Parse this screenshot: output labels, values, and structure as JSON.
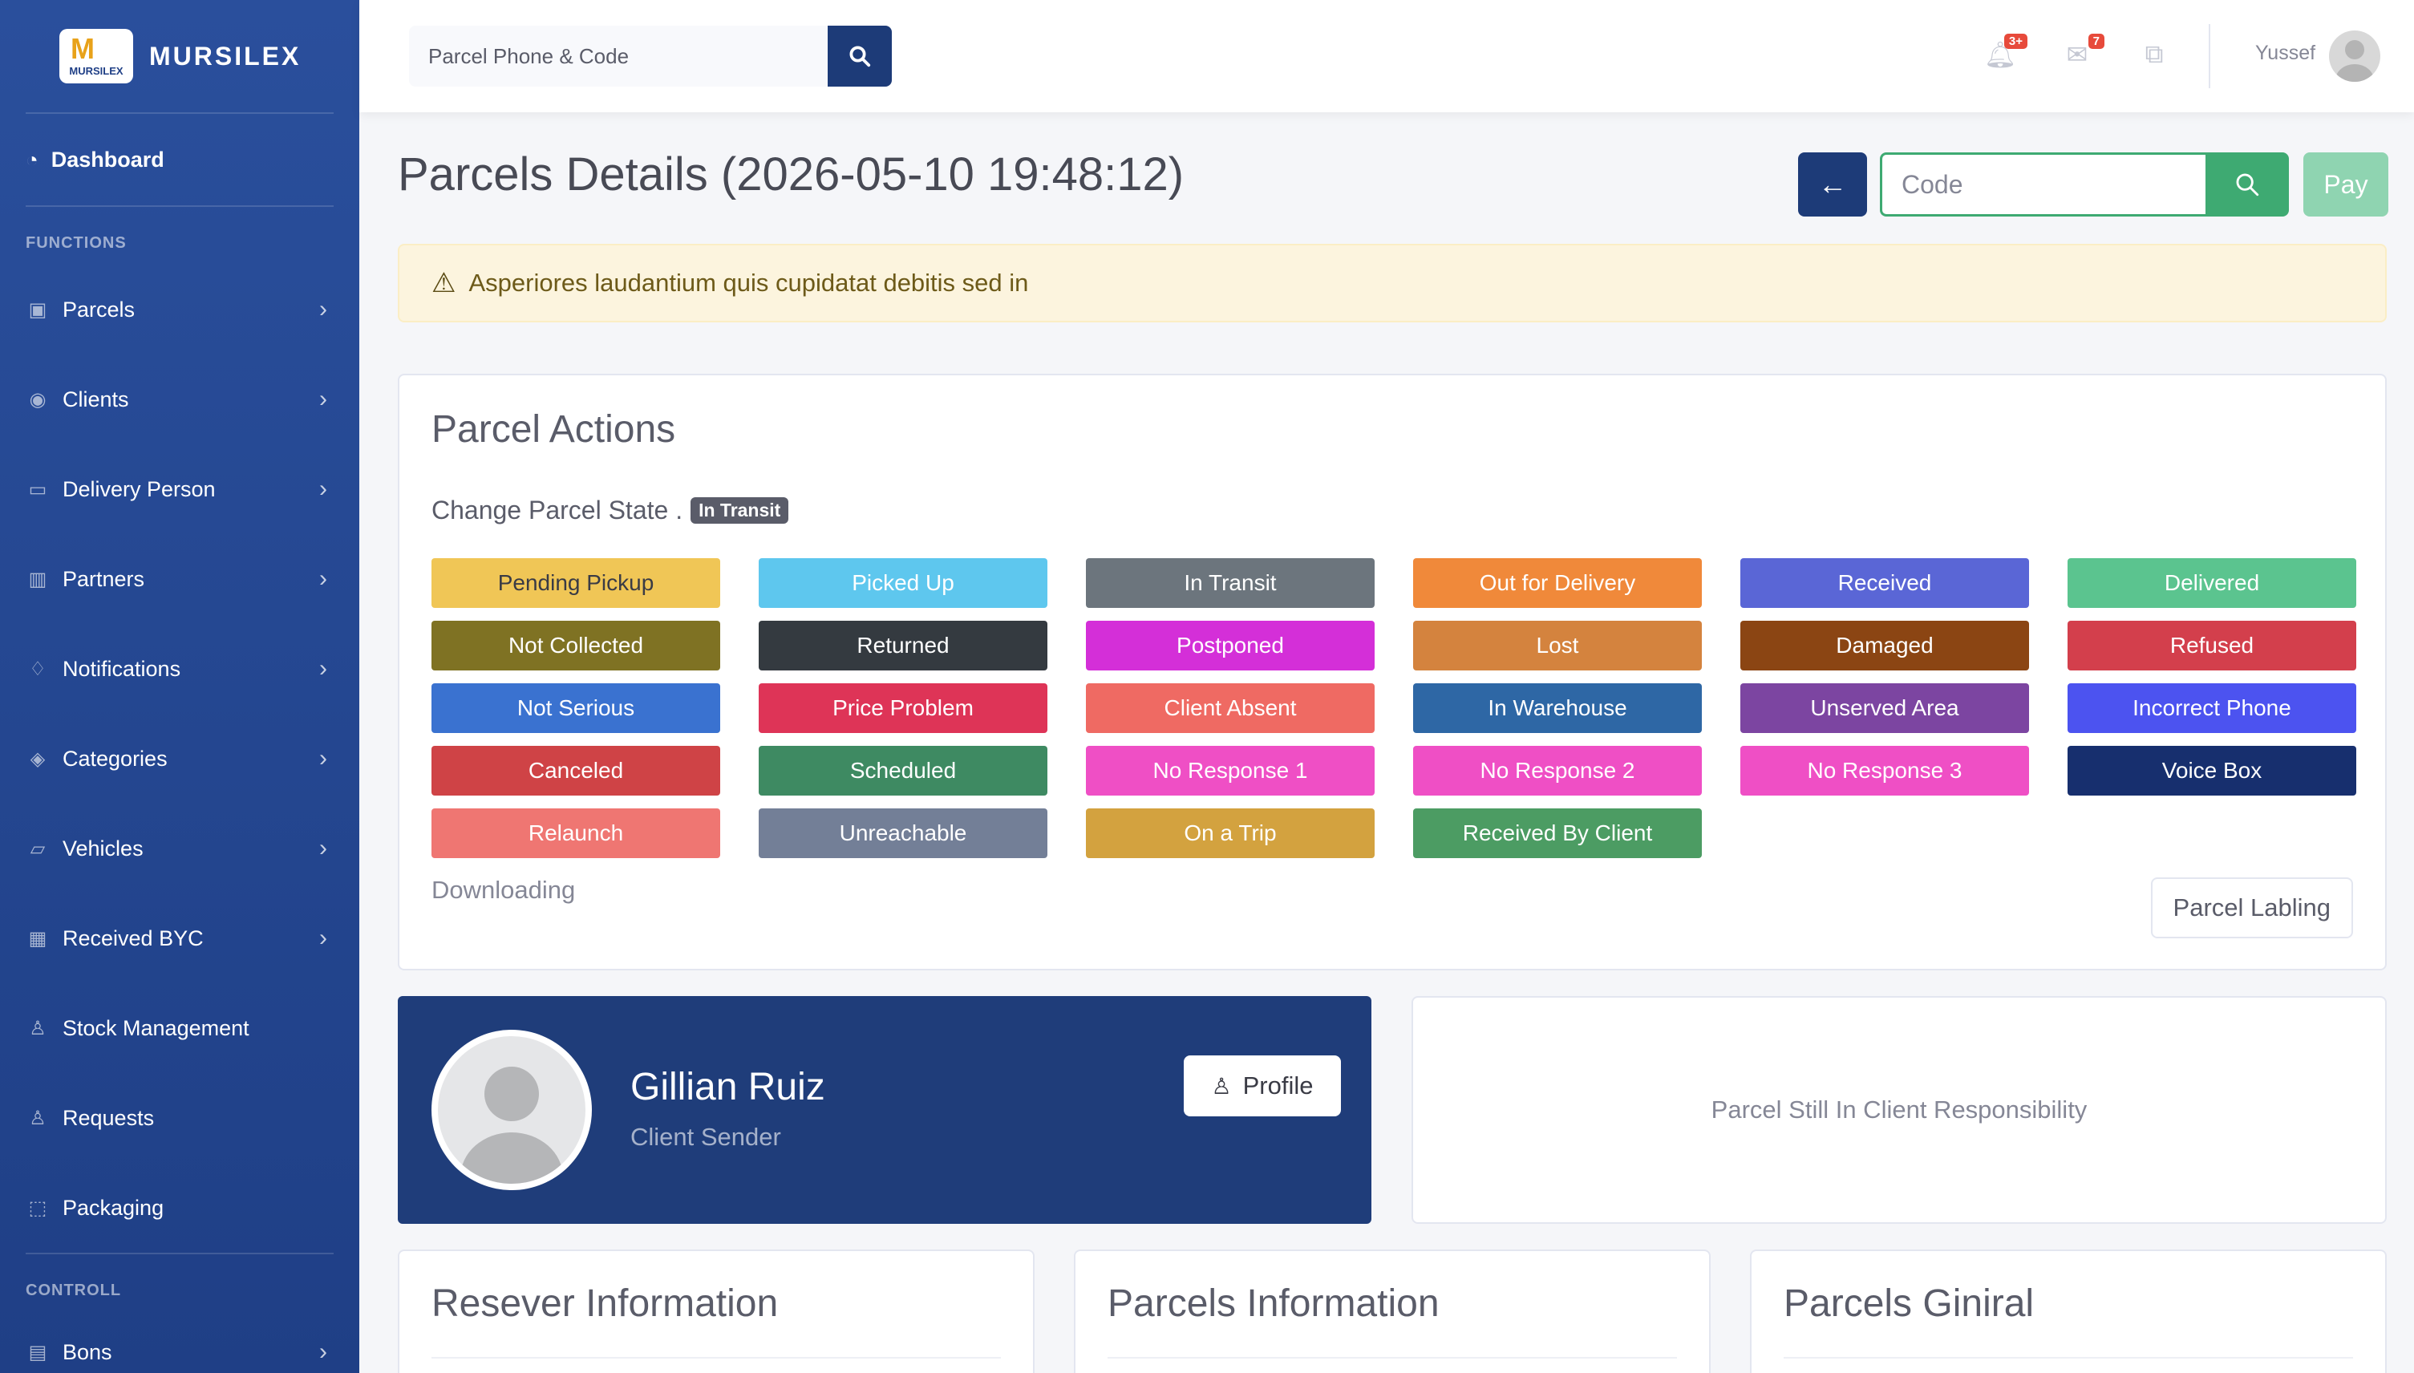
{
  "brand": {
    "name": "MURSILEX",
    "logo_text": "MURSILEX"
  },
  "sidebar": {
    "dashboard": "Dashboard",
    "heading_functions": "FUNCTIONS",
    "items": [
      {
        "label": "Parcels",
        "icon": "box-icon",
        "expandable": true
      },
      {
        "label": "Clients",
        "icon": "user-circle-icon",
        "expandable": true
      },
      {
        "label": "Delivery Person",
        "icon": "bus-icon",
        "expandable": true
      },
      {
        "label": "Partners",
        "icon": "building-icon",
        "expandable": true
      },
      {
        "label": "Notifications",
        "icon": "bell-icon",
        "expandable": true
      },
      {
        "label": "Categories",
        "icon": "tags-icon",
        "expandable": true
      },
      {
        "label": "Vehicles",
        "icon": "truck-icon",
        "expandable": true
      },
      {
        "label": "Received BYC",
        "icon": "grid-icon",
        "expandable": true
      },
      {
        "label": "Stock Management",
        "icon": "user-icon",
        "expandable": false
      },
      {
        "label": "Requests",
        "icon": "user-icon",
        "expandable": false
      },
      {
        "label": "Packaging",
        "icon": "package-icon",
        "expandable": false
      }
    ],
    "heading_controll": "CONTROLL",
    "bons": "Bons"
  },
  "topbar": {
    "search_placeholder": "Parcel Phone & Code",
    "alerts_badge": "3+",
    "messages_badge": "7",
    "user_name": "Yussef"
  },
  "page": {
    "title": "Parcels Details (2026-05-10 19:48:12)",
    "code_placeholder": "Code",
    "pay_label": "Pay",
    "alert_text": "Asperiores laudantium quis cupidatat debitis sed in"
  },
  "actions": {
    "title": "Parcel Actions",
    "change_state_label": "Change Parcel State .",
    "current_state": "In Transit",
    "states": [
      {
        "label": "Pending Pickup",
        "color": "#f0c656",
        "text": "#3a3b45"
      },
      {
        "label": "Picked Up",
        "color": "#5ec7ee",
        "text": "#ffffff"
      },
      {
        "label": "In Transit",
        "color": "#6c757d",
        "text": "#ffffff"
      },
      {
        "label": "Out for Delivery",
        "color": "#f0893a",
        "text": "#ffffff"
      },
      {
        "label": "Received",
        "color": "#5a66d6",
        "text": "#ffffff"
      },
      {
        "label": "Delivered",
        "color": "#5bc48f",
        "text": "#ffffff"
      },
      {
        "label": "Not Collected",
        "color": "#7f7223",
        "text": "#ffffff"
      },
      {
        "label": "Returned",
        "color": "#343a40",
        "text": "#ffffff"
      },
      {
        "label": "Postponed",
        "color": "#d42fd8",
        "text": "#ffffff"
      },
      {
        "label": "Lost",
        "color": "#d4833e",
        "text": "#ffffff"
      },
      {
        "label": "Damaged",
        "color": "#8b4513",
        "text": "#ffffff"
      },
      {
        "label": "Refused",
        "color": "#d33f4c",
        "text": "#ffffff"
      },
      {
        "label": "Not Serious",
        "color": "#3a72d0",
        "text": "#ffffff"
      },
      {
        "label": "Price Problem",
        "color": "#de3457",
        "text": "#ffffff"
      },
      {
        "label": "Client Absent",
        "color": "#ef6a63",
        "text": "#ffffff"
      },
      {
        "label": "In Warehouse",
        "color": "#2e67a5",
        "text": "#ffffff"
      },
      {
        "label": "Unserved Area",
        "color": "#7c45a1",
        "text": "#ffffff"
      },
      {
        "label": "Incorrect Phone",
        "color": "#4c53f0",
        "text": "#ffffff"
      },
      {
        "label": "Canceled",
        "color": "#cf4346",
        "text": "#ffffff"
      },
      {
        "label": "Scheduled",
        "color": "#3e8a62",
        "text": "#ffffff"
      },
      {
        "label": "No Response 1",
        "color": "#ef4fc5",
        "text": "#ffffff"
      },
      {
        "label": "No Response 2",
        "color": "#ef4fc5",
        "text": "#ffffff"
      },
      {
        "label": "No Response 3",
        "color": "#ef4fc5",
        "text": "#ffffff"
      },
      {
        "label": "Voice Box",
        "color": "#172f6e",
        "text": "#ffffff"
      },
      {
        "label": "Relaunch",
        "color": "#ef7672",
        "text": "#ffffff"
      },
      {
        "label": "Unreachable",
        "color": "#737f97",
        "text": "#ffffff"
      },
      {
        "label": "On a Trip",
        "color": "#d3a23f",
        "text": "#ffffff"
      },
      {
        "label": "Received By Client",
        "color": "#4c9c63",
        "text": "#ffffff"
      }
    ],
    "downloading_label": "Downloading",
    "labeling_button": "Parcel Labling"
  },
  "client": {
    "name": "Gillian Ruiz",
    "role": "Client Sender",
    "profile_button": "Profile"
  },
  "responsibility": {
    "text": "Parcel Still In Client Responsibility"
  },
  "info_cards": [
    "Resever Information",
    "Parcels Information",
    "Parcels Giniral"
  ]
}
